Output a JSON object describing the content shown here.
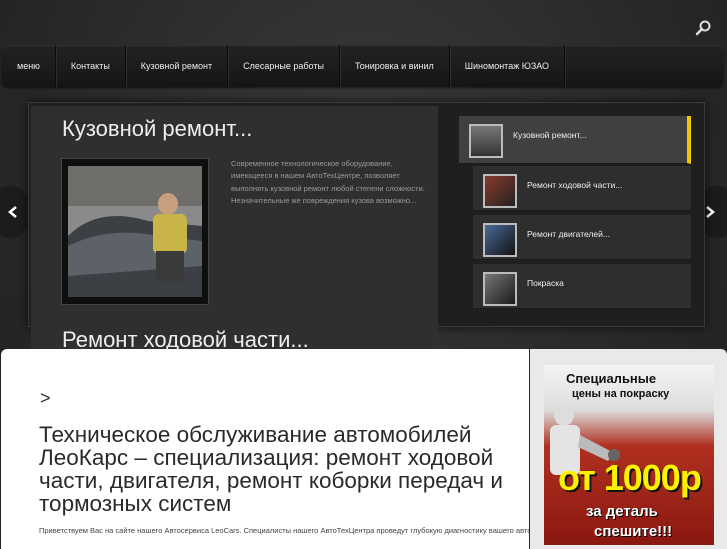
{
  "nav": {
    "items": [
      "меню",
      "Контакты",
      "Кузовной ремонт",
      "Слесарные работы",
      "Тонировка и винил",
      "Шиномонтаж ЮЗАО"
    ]
  },
  "slider": {
    "title": "Кузовной ремонт...",
    "text": "Современное технологическое оборудование, имеющееся в нашем АвтоТехЦентре, позволяет выполнять кузовной ремонт любой степени сложности. Незначительные же повреждения кузова возможно...",
    "thumbs": [
      {
        "label": "Кузовной ремонт..."
      },
      {
        "label": "Ремонт ходовой части..."
      },
      {
        "label": "Ремонт двигателей..."
      },
      {
        "label": "Покраска"
      }
    ],
    "next_title": "Ремонт ходовой части..."
  },
  "content": {
    "arrow": ">",
    "heading": "Техническое обслуживание автомобилей ЛеоКарс – специализация: ремонт ходовой части, двигателя, ремонт коборки передач и тормозных систем",
    "intro": "Приветствуем Вас на сайте нашего Автосервиса LeoCars. Специалисты нашего АвтоТехЦентра проведут глубокую диагностику вашего автомобиля. Помогут выявить не только явные, но и скрытые дефекты, а затем полностью"
  },
  "ad": {
    "line1": "Специальные",
    "line2": "цены на покраску",
    "line3": "от 1000р",
    "line4": "за деталь",
    "line5": "спешите!!!"
  },
  "colors": {
    "accent": "#f0c800",
    "background": "#2b2b2b"
  },
  "icons": {
    "search": "search-icon",
    "prev": "chevron-left-icon",
    "next": "chevron-right-icon"
  }
}
